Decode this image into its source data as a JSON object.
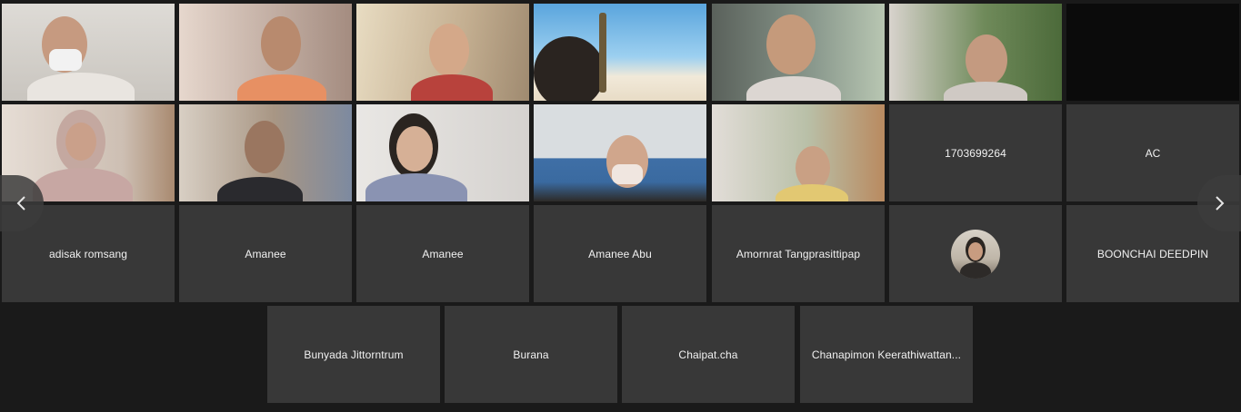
{
  "video_tiles": [
    {
      "id": "v1",
      "bg": "#d9d6d2"
    },
    {
      "id": "v2",
      "bg": "#b5a295"
    },
    {
      "id": "v3",
      "bg": "#c8b89c"
    },
    {
      "id": "v4",
      "bg": "#6fb3df"
    },
    {
      "id": "v5",
      "bg": "#7c8a82"
    },
    {
      "id": "v6",
      "bg": "#9aa68c"
    },
    {
      "id": "v7",
      "bg": "#d8ccc4"
    },
    {
      "id": "v8",
      "bg": "#8a8074"
    },
    {
      "id": "v9",
      "bg": "#d9d7d4"
    },
    {
      "id": "v10",
      "bg": "#4d76a8"
    },
    {
      "id": "v11",
      "bg": "#cdc7b8"
    }
  ],
  "participants": {
    "row2": [
      "1703699264",
      "AC"
    ],
    "row3": [
      "adisak romsang",
      "Amanee",
      "Amanee",
      "Amanee Abu",
      "Amornrat Tangprasittipap",
      "",
      "BOONCHAI DEEDPIN"
    ],
    "row4": [
      "Bunyada Jittorntrum",
      "Burana",
      "Chaipat.cha",
      "Chanapimon Keerathiwattan..."
    ]
  },
  "nav": {
    "prev_label": "‹",
    "next_label": "›"
  },
  "colors": {
    "background": "#1a1a1a",
    "tile": "#383838",
    "text": "#f1f1f1"
  }
}
